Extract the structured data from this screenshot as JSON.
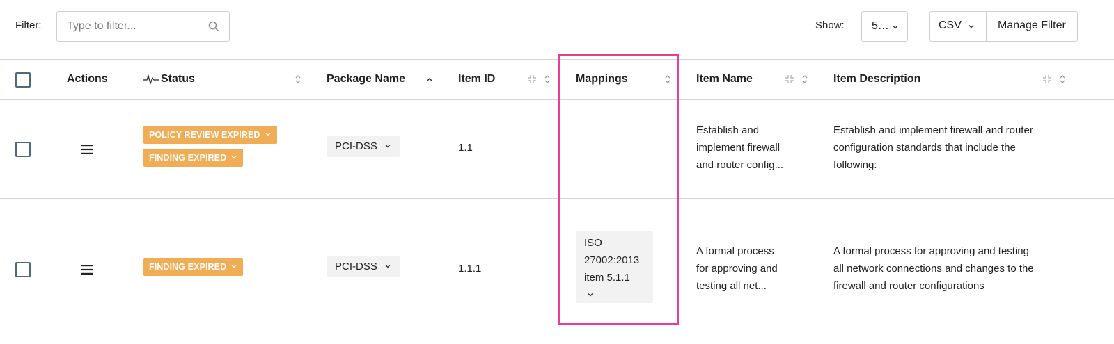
{
  "toolbar": {
    "filter_label": "Filter:",
    "filter_placeholder": "Type to filter...",
    "show_label": "Show:",
    "show_value": "5…",
    "csv_label": "CSV",
    "manage_filter_label": "Manage Filter"
  },
  "table": {
    "headers": {
      "actions": "Actions",
      "status": "Status",
      "package_name": "Package Name",
      "item_id": "Item ID",
      "mappings": "Mappings",
      "item_name": "Item Name",
      "item_description": "Item Description"
    },
    "rows": [
      {
        "status_badges": [
          "POLICY REVIEW EXPIRED",
          "FINDING EXPIRED"
        ],
        "package": "PCI-DSS",
        "item_id": "1.1",
        "mappings": [],
        "item_name": [
          "Establish and",
          "implement firewall",
          "and router config..."
        ],
        "item_description": [
          "Establish and implement firewall and router",
          "configuration standards that include the",
          "following:"
        ]
      },
      {
        "status_badges": [
          "FINDING EXPIRED"
        ],
        "package": "PCI-DSS",
        "item_id": "1.1.1",
        "mappings": [
          "ISO",
          "27002:2013",
          "item 5.1.1"
        ],
        "item_name": [
          "A formal process",
          "for approving and",
          "testing all net..."
        ],
        "item_description": [
          "A formal process for approving and testing",
          "all network connections and changes to the",
          "firewall and router configurations"
        ]
      }
    ]
  },
  "colors": {
    "badge": "#f0ad55",
    "highlight": "#ea3d95",
    "checkbox_border": "#4f6a80"
  }
}
